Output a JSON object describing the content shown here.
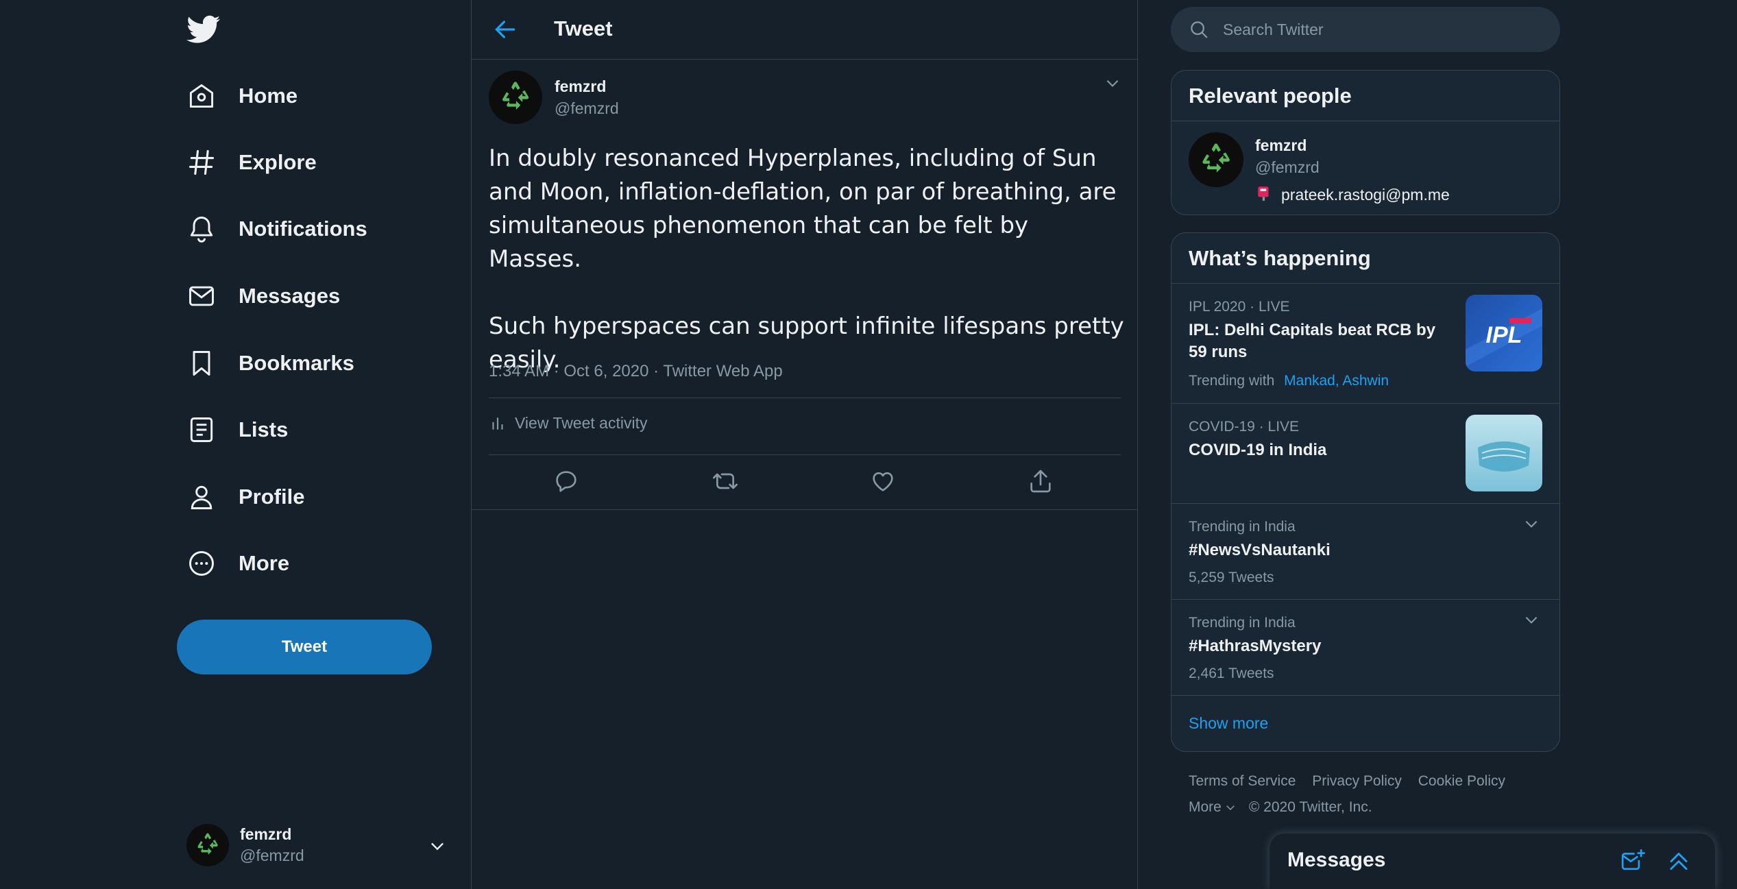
{
  "colors": {
    "accent": "#1da1f2",
    "background": "#15202b",
    "panel": "#192734",
    "border": "#38444d",
    "muted": "#8899a6",
    "tweet_button": "#1775b8"
  },
  "nav": {
    "logo_icon": "twitter-bird-icon",
    "items": [
      {
        "label": "Home",
        "icon": "home-icon"
      },
      {
        "label": "Explore",
        "icon": "hashtag-icon"
      },
      {
        "label": "Notifications",
        "icon": "bell-icon"
      },
      {
        "label": "Messages",
        "icon": "envelope-icon"
      },
      {
        "label": "Bookmarks",
        "icon": "bookmark-icon"
      },
      {
        "label": "Lists",
        "icon": "list-icon"
      },
      {
        "label": "Profile",
        "icon": "person-icon"
      },
      {
        "label": "More",
        "icon": "more-circle-icon"
      }
    ],
    "tweet_button": "Tweet",
    "account": {
      "name": "femzrd",
      "handle": "@femzrd"
    }
  },
  "main": {
    "header_title": "Tweet",
    "tweet": {
      "author_name": "femzrd",
      "author_handle": "@femzrd",
      "text": "In doubly resonanced Hyperplanes, including of Sun and Moon, inflation-deflation, on par of breathing, are simultaneous phenomenon that can be felt by Masses.\n\nSuch hyperspaces can support infinite lifespans pretty easily.",
      "meta": "1:34 AM · Oct 6, 2020 · Twitter Web App",
      "activity_label": "View Tweet activity"
    }
  },
  "sidebar": {
    "search_placeholder": "Search Twitter",
    "relevant": {
      "title": "Relevant people",
      "name": "femzrd",
      "handle": "@femzrd",
      "bio": "prateek.rastogi@pm.me"
    },
    "happening": {
      "title": "What’s happening",
      "trends": [
        {
          "context": "IPL 2020 · LIVE",
          "title": "IPL: Delhi Capitals beat RCB by 59 runs",
          "trending_with_label": "Trending with",
          "trending_with": "Mankad, Ashwin",
          "image": "IPL"
        },
        {
          "context": "COVID-19 · LIVE",
          "title": "COVID-19 in India"
        },
        {
          "context": "Trending in India",
          "title": "#NewsVsNautanki",
          "count": "5,259 Tweets"
        },
        {
          "context": "Trending in India",
          "title": "#HathrasMystery",
          "count": "2,461 Tweets"
        }
      ],
      "show_more": "Show more"
    },
    "footer": {
      "links": [
        "Terms of Service",
        "Privacy Policy",
        "Cookie Policy"
      ],
      "more": "More",
      "copyright": "© 2020 Twitter, Inc."
    }
  },
  "messages_drawer": {
    "title": "Messages"
  }
}
